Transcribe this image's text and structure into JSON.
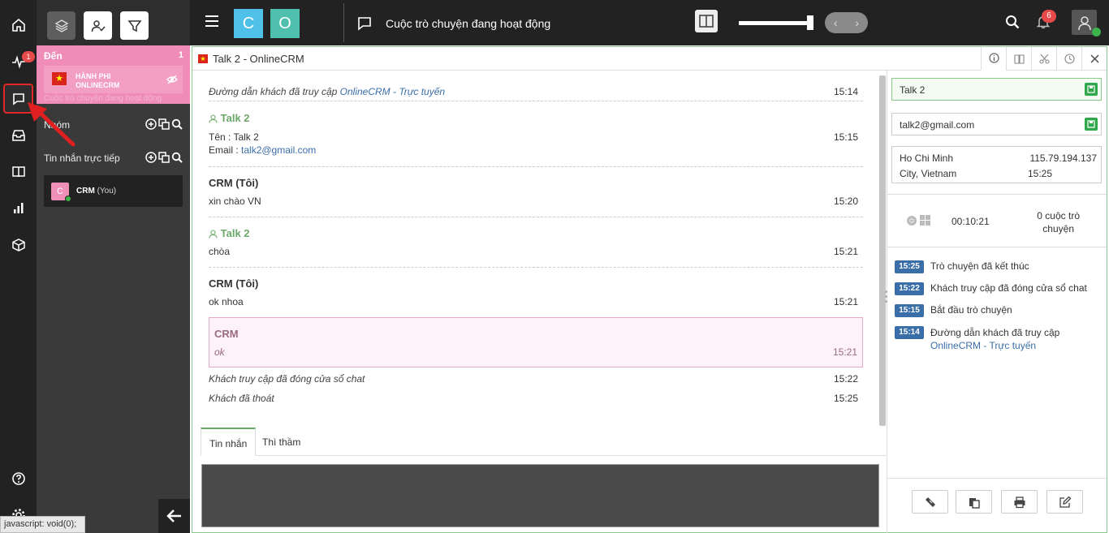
{
  "rail": {
    "activity_badge": "1"
  },
  "incoming": {
    "header": "Đến",
    "count": "1",
    "visitor_name_line1": "HÀNH PHI",
    "visitor_name_line2": "ONLINECRM",
    "subtitle": "Cuộc trò chuyện đang hoạt động"
  },
  "groups": {
    "label": "Nhóm"
  },
  "direct": {
    "label": "Tin nhắn trực tiếp",
    "item": {
      "avatar": "C",
      "name": "CRM",
      "suffix": "(You)"
    }
  },
  "status_bar": "javascript: void(0);",
  "topbar": {
    "tile1": "C",
    "tile2": "O",
    "title": "Cuộc trò chuyện đang hoạt động",
    "notif_count": "6"
  },
  "panel": {
    "title": "Talk 2 - OnlineCRM"
  },
  "chat": {
    "system_visit_prefix": "Đường dẫn khách đã truy cập",
    "system_visit_link": "OnlineCRM - Trực tuyến",
    "system_visit_time": "15:14",
    "visitor_name": "Talk 2",
    "info_name": "Tên : Talk 2",
    "info_email_label": "Email :",
    "info_email": "talk2@gmail.com",
    "info_time": "15:15",
    "op_name": "CRM (Tôi)",
    "msg1": "xin chào VN",
    "msg1_time": "15:20",
    "visitor_name2": "Talk 2",
    "msg2": "chòa",
    "msg2_time": "15:21",
    "op_name2": "CRM (Tôi)",
    "msg3": "ok nhoa",
    "msg3_time": "15:21",
    "crm_name": "CRM",
    "crm_msg": "ok",
    "crm_time": "15:21",
    "closed": "Khách truy cập đã đóng cửa sổ chat",
    "closed_time": "15:22",
    "left": "Khách đã thoát",
    "left_time": "15:25"
  },
  "tabs": {
    "messages": "Tin nhắn",
    "whisper": "Thì thầm"
  },
  "side": {
    "name_value": "Talk 2",
    "email_value": "talk2@gmail.com",
    "city_line1": "Ho Chi Minh",
    "city_line2": "City, Vietnam",
    "ip": "115.79.194.137",
    "local_time": "15:25",
    "duration": "00:10:21",
    "chats_line1": "0 cuộc trò",
    "chats_line2": "chuyện",
    "events": [
      {
        "time": "15:25",
        "text": "Trò chuyện đã kết thúc"
      },
      {
        "time": "15:22",
        "text": "Khách truy cập đã đóng cửa sổ chat"
      },
      {
        "time": "15:15",
        "text": "Bắt đầu trò chuyện"
      },
      {
        "time": "15:14",
        "text": "Đường dẫn khách đã truy cập",
        "link": "OnlineCRM - Trực tuyến"
      }
    ]
  },
  "colors": {
    "accent_green": "#6aa86a",
    "incoming_pink": "#ef8db8",
    "event_blue": "#3a6ea8",
    "badge_red": "#e64a4a"
  }
}
